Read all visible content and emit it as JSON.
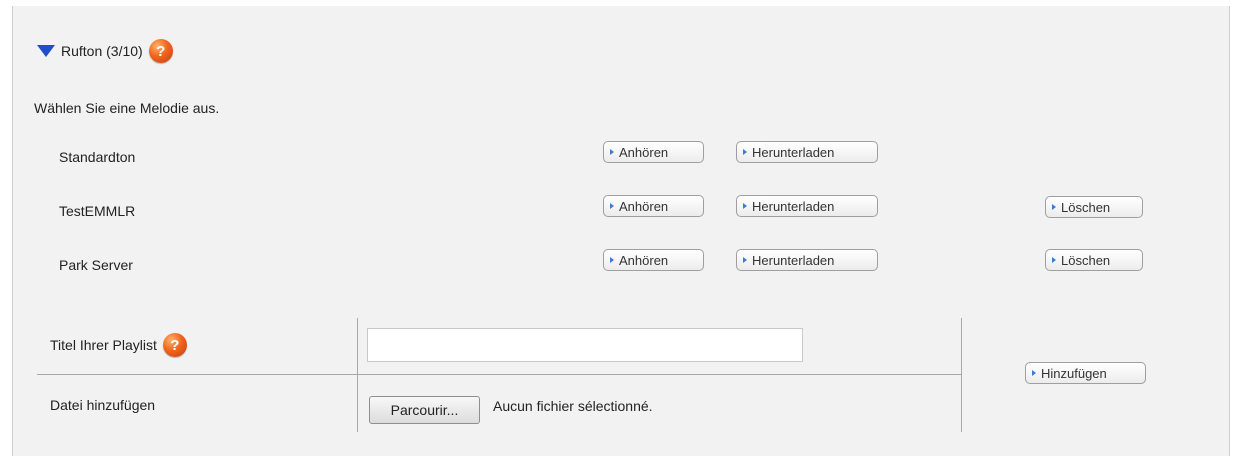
{
  "ringtone": {
    "header": "Rufton (3/10)",
    "instruction": "Wählen Sie eine Melodie aus.",
    "items": [
      {
        "name": "Standardton",
        "listen": "Anhören",
        "download": "Herunterladen"
      },
      {
        "name": "TestEMMLR",
        "listen": "Anhören",
        "download": "Herunterladen",
        "delete": "Löschen"
      },
      {
        "name": "Park Server",
        "listen": "Anhören",
        "download": "Herunterladen",
        "delete": "Löschen"
      }
    ]
  },
  "playlist": {
    "title_label": "Titel Ihrer Playlist",
    "title_value": "",
    "file_label": "Datei hinzufügen",
    "browse_label": "Parcourir...",
    "no_file_text": "Aucun fichier sélectionné.",
    "add_label": "Hinzufügen"
  },
  "colors": {
    "accent": "#1f4fc8",
    "help_icon": "#f0651e",
    "panel_bg": "#f2f2f2"
  }
}
